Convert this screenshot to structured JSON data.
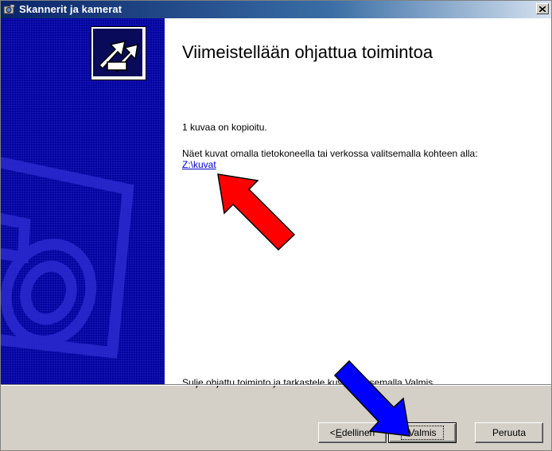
{
  "window": {
    "title": "Skannerit ja kamerat",
    "close_label": "×"
  },
  "content": {
    "heading": "Viimeistellään ohjattua toimintoa",
    "copied_text": "1 kuvaa on kopioitu.",
    "view_text": "Näet kuvat omalla tietokoneella tai verkossa valitsemalla kohteen alla:",
    "folder_link": "Z:\\kuvat",
    "finish_text": "Sulje ohjattu toiminto ja tarkastele kuvia valitsemalla Valmis"
  },
  "buttons": {
    "back_prefix": "< ",
    "back_mnemonic": "E",
    "back_rest": "dellinen",
    "finish": "Valmis",
    "cancel": "Peruuta"
  },
  "annotations": {
    "red_arrow_color": "#ff0000",
    "blue_arrow_color": "#0000ff"
  },
  "icons": [
    "scanner-camera-icon",
    "close-icon",
    "wizard-arrows-icon"
  ]
}
